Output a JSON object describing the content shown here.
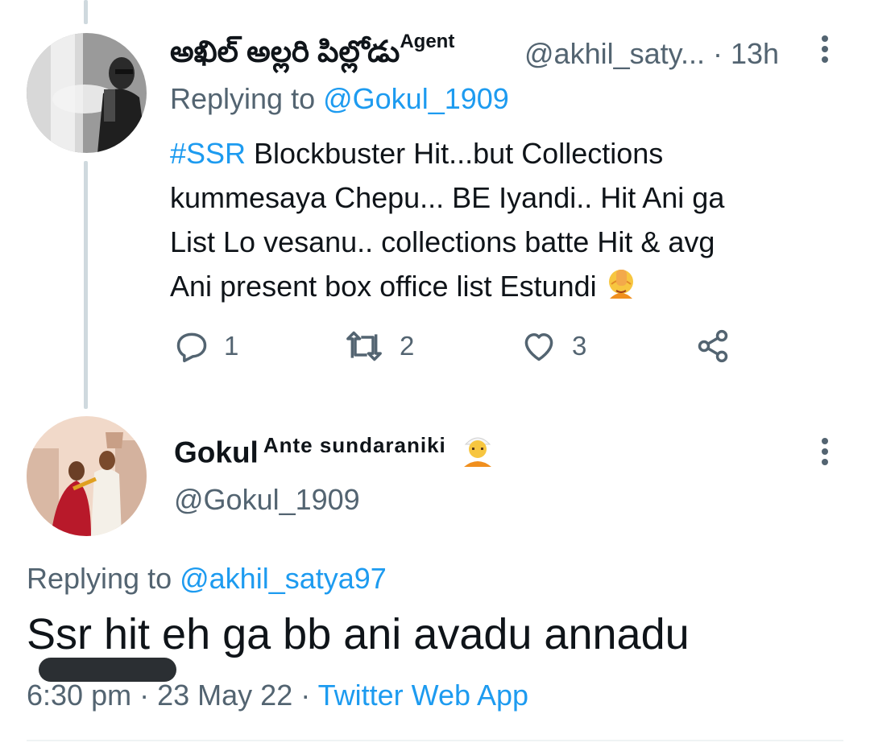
{
  "tweet1": {
    "display_name": "అఖిల్ అల్లరి పిల్లోడు",
    "name_suffix": "Agent",
    "handle": "@akhil_saty...",
    "separator": "·",
    "time": "13h",
    "replying_prefix": "Replying to ",
    "replying_handle": "@Gokul_1909",
    "hashtag": "#SSR",
    "text": " Blockbuster Hit...but Collections\nkummesaya Chepu... BE Iyandi.. Hit Ani ga\nList Lo vesanu.. collections batte Hit & avg\nAni present box office list Estundi ",
    "emoji_icon": "face-palm-emoji",
    "actions": {
      "reply_count": "1",
      "retweet_count": "2",
      "like_count": "3"
    }
  },
  "tweet2": {
    "display_name": "Gokul",
    "name_suffix": "Ante sundaraniki",
    "name_emoji_icon": "man-with-turban-emoji",
    "handle": "@Gokul_1909",
    "replying_prefix": "Replying to ",
    "replying_handle": "@akhil_satya97",
    "text": "Ssr hit eh ga bb ani avadu annadu",
    "time": "6:30 pm",
    "separator": "·",
    "date": "23 May 22",
    "separator2": "·",
    "source": "Twitter Web App"
  },
  "colors": {
    "link": "#1d9bf0",
    "secondary_text": "#536471",
    "primary_text": "#0f1419",
    "thread_line": "#cfd9de"
  }
}
